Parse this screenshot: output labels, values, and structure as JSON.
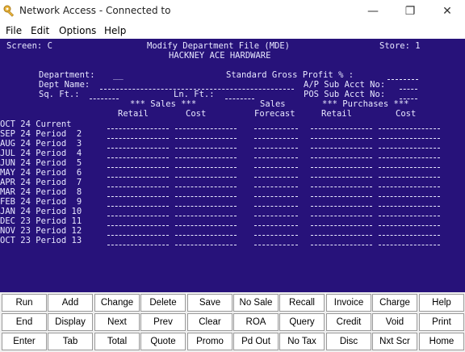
{
  "window": {
    "title": "Network Access - Connected to",
    "minimize_glyph": "—",
    "maximize_glyph": "❐",
    "close_glyph": "✕"
  },
  "menu": {
    "file": "File",
    "edit": "Edit",
    "options": "Options",
    "help": "Help"
  },
  "header": {
    "screen": "Screen: C",
    "title": "Modify Department File (MDE)",
    "store": "Store: 1",
    "company": "HACKNEY ACE HARDWARE"
  },
  "fields": {
    "department": "Department:",
    "department_value": "__",
    "dept_name": "Dept Name:",
    "sq_ft": "Sq. Ft.:",
    "ln_ft": "Ln. Ft.:",
    "standard_gross_profit": "Standard Gross Profit % :",
    "ap_sub_acct": "A/P Sub Acct No:",
    "pos_sub_acct": "POS Sub Acct No:"
  },
  "columns": {
    "sales_group": "*** Sales ***",
    "sales_forecast_top": "Sales",
    "purchases_group": "*** Purchases ***",
    "retail": "Retail",
    "cost": "Cost",
    "forecast": "Forecast",
    "p_retail": "Retail",
    "p_cost": "Cost"
  },
  "periods": [
    "OCT 24 Current",
    "SEP 24 Period  2",
    "AUG 24 Period  3",
    "JUL 24 Period  4",
    "JUN 24 Period  5",
    "MAY 24 Period  6",
    "APR 24 Period  7",
    "MAR 24 Period  8",
    "FEB 24 Period  9",
    "JAN 24 Period 10",
    "DEC 23 Period 11",
    "NOV 23 Period 12",
    "OCT 23 Period 13"
  ],
  "buttons": [
    [
      "Run",
      "Add",
      "Change",
      "Delete",
      "Save",
      "No Sale",
      "Recall",
      "Invoice",
      "Charge",
      "Help"
    ],
    [
      "End",
      "Display",
      "Next",
      "Prev",
      "Clear",
      "ROA",
      "Query",
      "Credit",
      "Void",
      "Print"
    ],
    [
      "Enter",
      "Tab",
      "Total",
      "Quote",
      "Promo",
      "Pd Out",
      "No Tax",
      "Disc",
      "Nxt Scr",
      "Home"
    ]
  ],
  "colors": {
    "terminal_bg": "#27127a",
    "terminal_fg": "#e8e8ff"
  }
}
